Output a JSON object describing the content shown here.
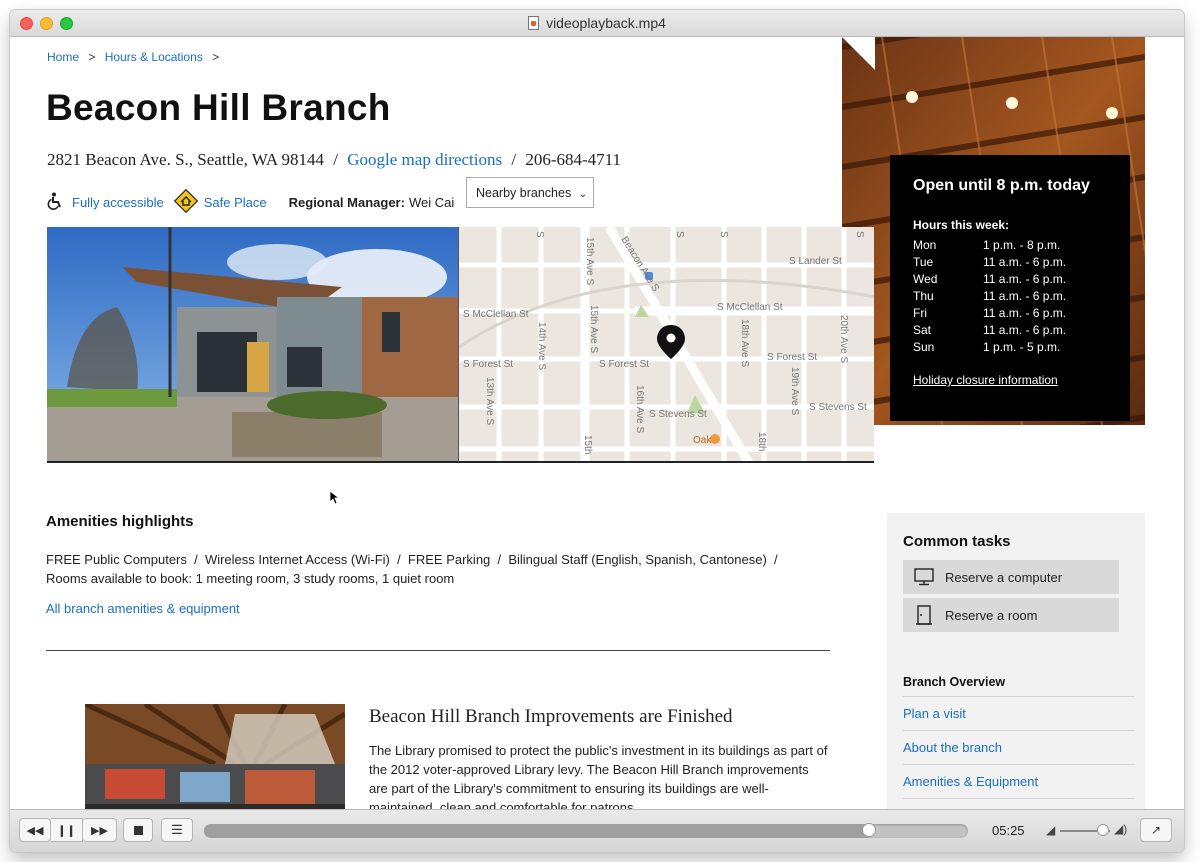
{
  "window": {
    "title": "videoplayback.mp4"
  },
  "breadcrumb": {
    "home": "Home",
    "sep1": ">",
    "hours": "Hours & Locations",
    "sep2": ">"
  },
  "branch": {
    "title": "Beacon Hill Branch",
    "address": "2821 Beacon Ave. S., Seattle, WA 98144",
    "slash1": "/",
    "directions": "Google map directions",
    "slash2": "/",
    "phone": "206-684-4711",
    "accessible": "Fully accessible",
    "safe_place": "Safe Place",
    "manager_label": "Regional Manager:",
    "manager_name": "Wei Cai",
    "nearby": "Nearby branches"
  },
  "map": {
    "streets": [
      "S Lander St",
      "S McClellan St",
      "S McClellan St",
      "S Forest St",
      "S Forest St",
      "S Forest St",
      "S Stevens St",
      "S Stevens St",
      "15th Ave S",
      "15th Ave S",
      "14th Ave S",
      "13th Ave S",
      "16th Ave S",
      "18th Ave S",
      "19th Ave S",
      "20th Ave S",
      "18th",
      "Beacon Ave S",
      "S",
      "S",
      "S",
      "S",
      "15th"
    ],
    "poi": "Oak"
  },
  "hours": {
    "status": "Open until 8 p.m. today",
    "week_label": "Hours this week:",
    "days": [
      {
        "day": "Mon",
        "time": "1 p.m. - 8 p.m."
      },
      {
        "day": "Tue",
        "time": "11 a.m. - 6 p.m."
      },
      {
        "day": "Wed",
        "time": "11 a.m. - 6 p.m."
      },
      {
        "day": "Thu",
        "time": "11 a.m. - 6 p.m."
      },
      {
        "day": "Fri",
        "time": "11 a.m. - 6 p.m."
      },
      {
        "day": "Sat",
        "time": "11 a.m. - 6 p.m."
      },
      {
        "day": "Sun",
        "time": "1 p.m. - 5 p.m."
      }
    ],
    "holiday": "Holiday closure information"
  },
  "amenities": {
    "heading": "Amenities highlights",
    "line1": "FREE Public Computers  /  Wireless Internet Access (Wi-Fi)  /  FREE Parking  /  Bilingual Staff (English, Spanish, Cantonese)  /",
    "line2": "Rooms available to book: 1 meeting room, 3 study rooms, 1 quiet room",
    "link": "All branch amenities & equipment"
  },
  "news": {
    "title": "Beacon Hill Branch Improvements are Finished",
    "body": "The Library promised to protect the public's investment in its buildings as part of the 2012 voter-approved Library levy. The Beacon Hill Branch improvements are part of the Library's commitment to ensuring its buildings are well-maintained, clean and comfortable for patrons."
  },
  "sidebar": {
    "tasks_heading": "Common tasks",
    "task_computer": "Reserve a computer",
    "task_room": "Reserve a room",
    "overview_heading": "Branch Overview",
    "links": [
      "Plan a visit",
      "About the branch",
      "Amenities & Equipment"
    ]
  },
  "player": {
    "time": "05:25",
    "progress": 0.87,
    "volume": 0.85
  },
  "colors": {
    "link": "#1a6fc4",
    "hours_bg": "#000000",
    "sidebar_bg": "#f2f2f2"
  }
}
